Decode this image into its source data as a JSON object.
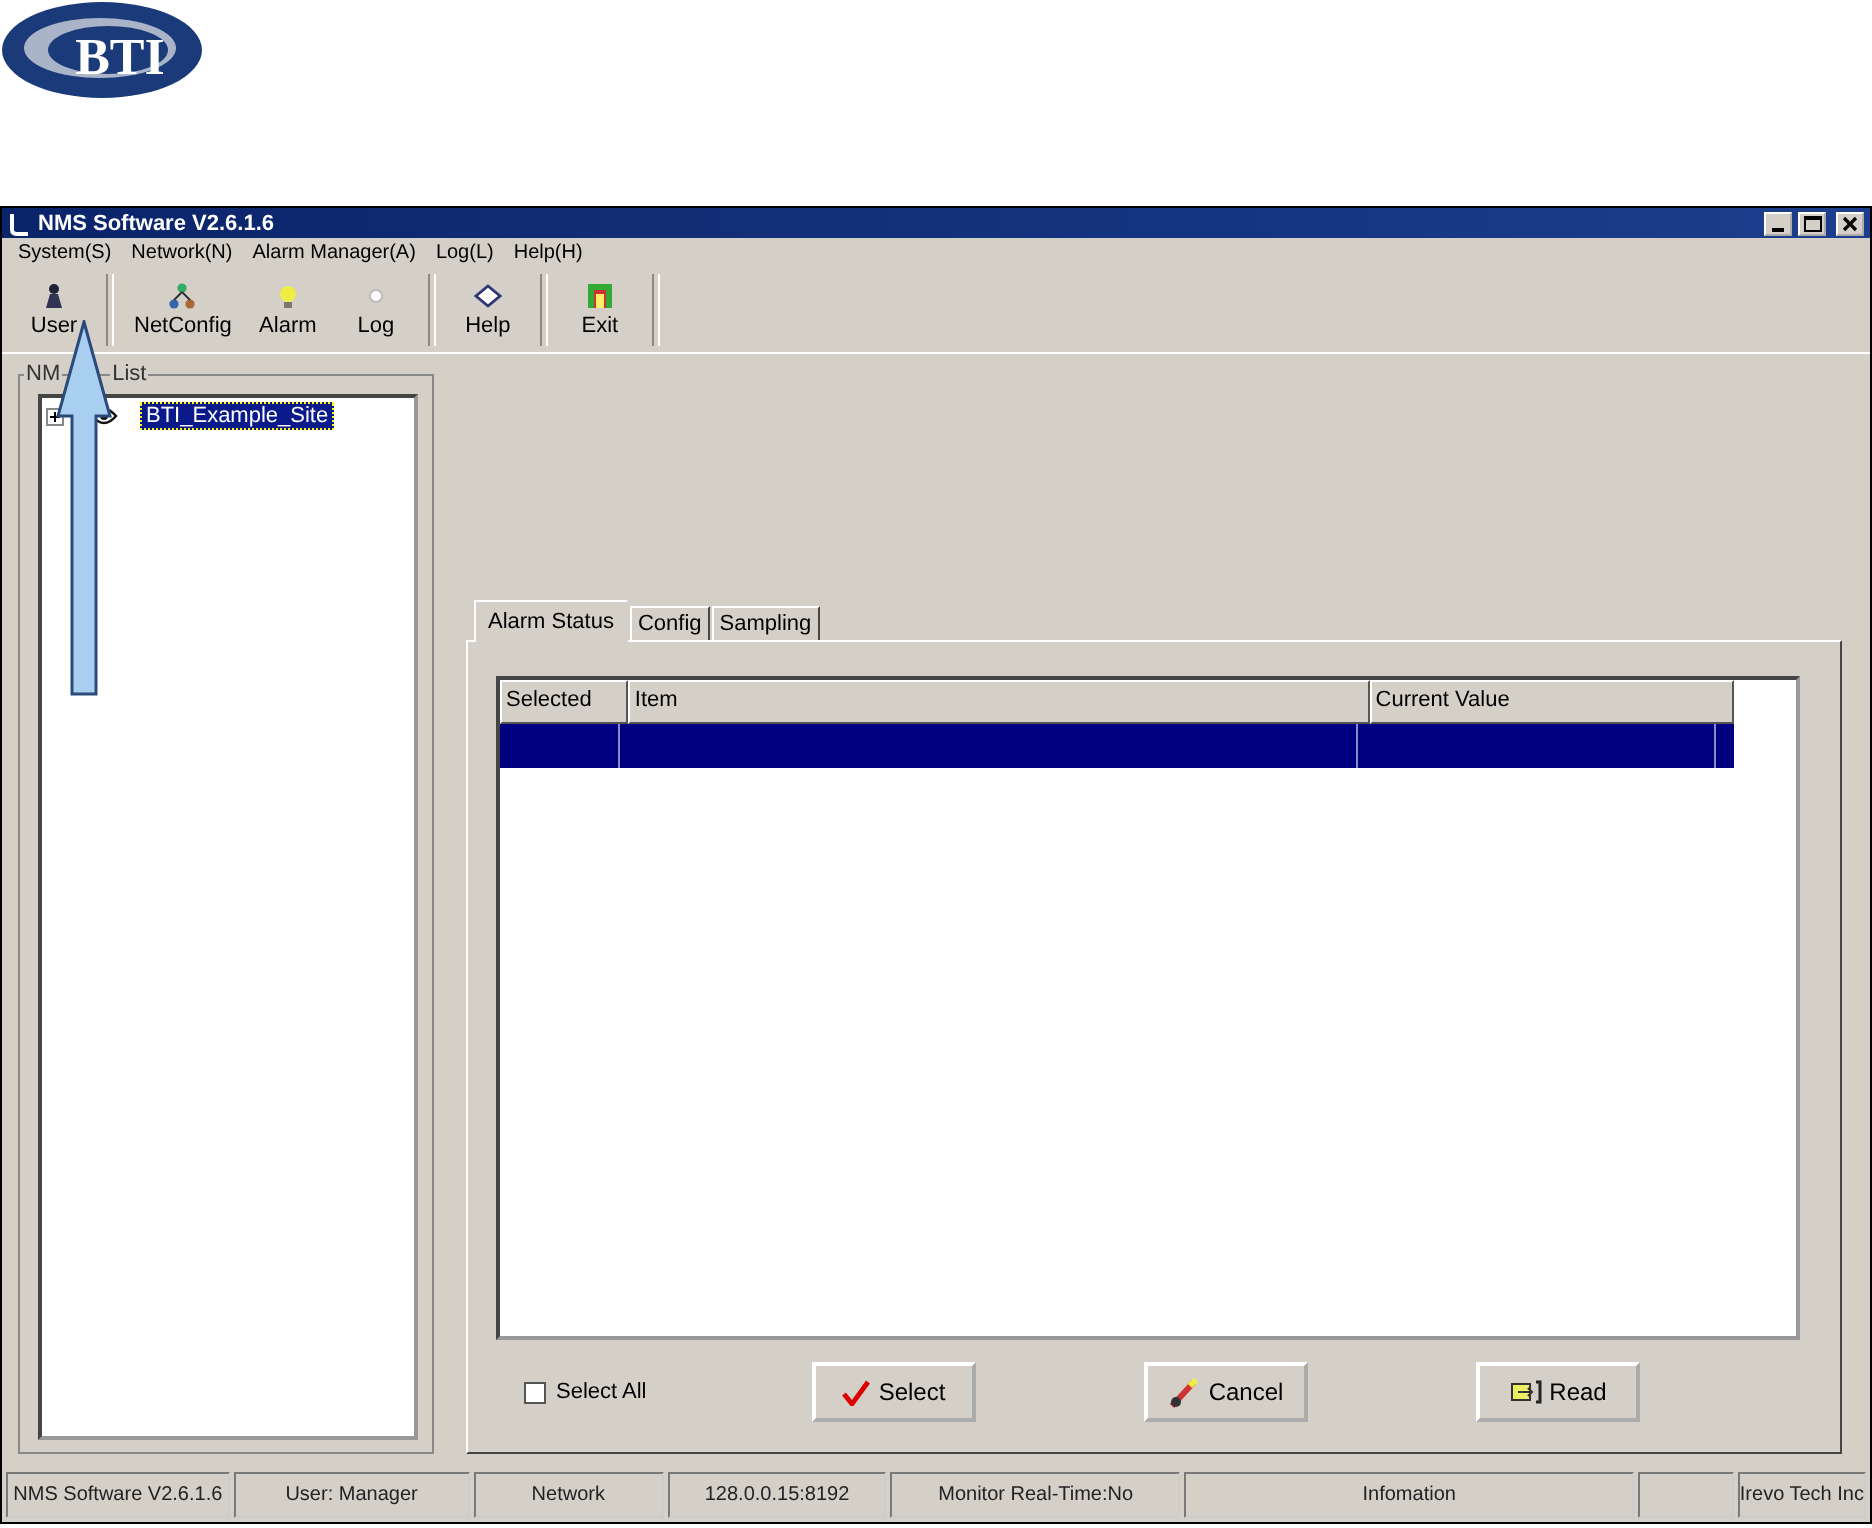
{
  "logo": {
    "text": "BTI"
  },
  "window": {
    "title": "NMS Software V2.6.1.6"
  },
  "menu": [
    "System(S)",
    "Network(N)",
    "Alarm Manager(A)",
    "Log(L)",
    "Help(H)"
  ],
  "toolbar_groups": [
    {
      "buttons": [
        {
          "label": "User",
          "kind": "user"
        }
      ]
    },
    {
      "buttons": [
        {
          "label": "NetConfig",
          "kind": "network"
        },
        {
          "label": "Alarm",
          "kind": "bulb"
        },
        {
          "label": "Log",
          "kind": "log"
        }
      ]
    },
    {
      "buttons": [
        {
          "label": "Help",
          "kind": "help"
        }
      ]
    },
    {
      "buttons": [
        {
          "label": "Exit",
          "kind": "exit"
        }
      ]
    }
  ],
  "tree": {
    "group_label": [
      "NM",
      "List"
    ],
    "items": [
      {
        "label": "BTI_Example_Site",
        "selected": true,
        "expanded": false
      }
    ]
  },
  "tabs": [
    {
      "label": "Alarm Status",
      "selected": true
    },
    {
      "label": "Config",
      "selected": false
    },
    {
      "label": "Sampling",
      "selected": false
    }
  ],
  "table": {
    "columns": [
      "Selected",
      "Item",
      "Current Value"
    ],
    "rows": [
      {
        "selected": true
      }
    ]
  },
  "select_all": {
    "label": "Select All",
    "checked": false
  },
  "buttons": [
    {
      "label": "Select",
      "kind": "check"
    },
    {
      "label": "Cancel",
      "kind": "cancel"
    },
    {
      "label": "Read",
      "kind": "read"
    }
  ],
  "status_bar": [
    "NMS Software V2.6.1.6",
    "User: Manager",
    "Network",
    "128.0.0.15:8192",
    "Monitor Real-Time:No",
    "Infomation",
    "Irevo Tech Inc"
  ]
}
